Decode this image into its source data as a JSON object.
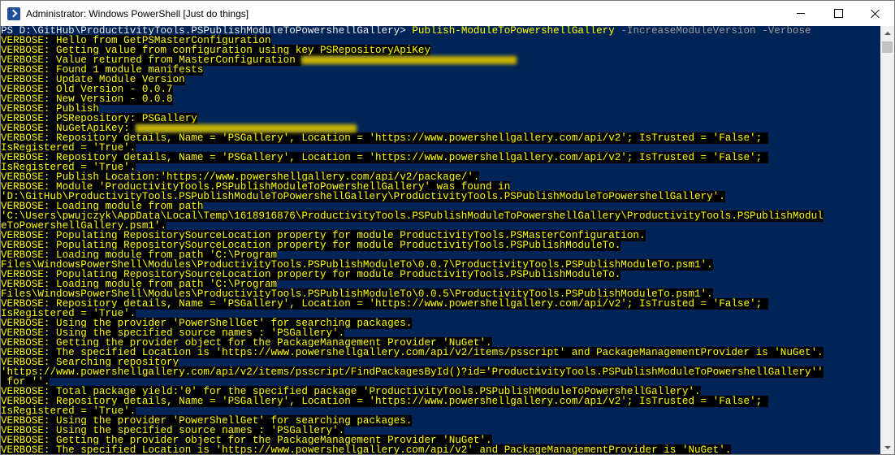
{
  "window": {
    "title": "Administrator: Windows PowerShell [Just do things]"
  },
  "colors": {
    "console_bg": "#012456",
    "verbose_fg": "#ffff00",
    "verbose_bg": "#000000",
    "param_fg": "#9a9a9a"
  },
  "icons": {
    "app": "powershell-icon",
    "minimize": "minimize-icon",
    "maximize": "maximize-icon",
    "close": "close-icon"
  },
  "console": {
    "prompt": "PS D:\\GitHub\\ProductivityTools.PSPublishModuleToPowershellGallery> ",
    "command": "Publish-ModuleToPowershellGallery",
    "parameters": " -IncreaseModuleVersion -Verbose",
    "lines": [
      {
        "text": "VERBOSE: Hello from GetPSMasterConfiguration"
      },
      {
        "text": "VERBOSE: Getting value from configuration using key PSRepositoryApiKey"
      },
      {
        "text": "VERBOSE: Value returned from MasterConfiguration ",
        "redacted": "xxxxxxxxxxxxxxxxxxxxxxxxxxxxxxxxxxx"
      },
      {
        "text": "VERBOSE: Found 1 module manifests"
      },
      {
        "text": "VERBOSE: Update Module Version"
      },
      {
        "text": "VERBOSE: Old Version - 0.0.7"
      },
      {
        "text": "VERBOSE: New Version - 0.0.8"
      },
      {
        "text": "VERBOSE: Publish"
      },
      {
        "text": "VERBOSE: PSRepository: PSGallery"
      },
      {
        "text": "VERBOSE: NuGetApiKey: ",
        "redacted": "xxxxxxxxxxxxxxxxxxxxxxxxxxxxxxxxxxxx"
      },
      {
        "text": "VERBOSE: Repository details, Name = 'PSGallery', Location = 'https://www.powershellgallery.com/api/v2'; IsTrusted = 'False'; "
      },
      {
        "text": "IsRegistered = 'True'."
      },
      {
        "text": "VERBOSE: Repository details, Name = 'PSGallery', Location = 'https://www.powershellgallery.com/api/v2'; IsTrusted = 'False'; "
      },
      {
        "text": "IsRegistered = 'True'."
      },
      {
        "text": "VERBOSE: Publish Location:'https://www.powershellgallery.com/api/v2/package/'."
      },
      {
        "text": "VERBOSE: Module 'ProductivityTools.PSPublishModuleToPowershellGallery' was found in"
      },
      {
        "text": "'D:\\GitHub\\ProductivityTools.PSPublishModuleToPowershellGallery\\ProductivityTools.PSPublishModuleToPowershellGallery'."
      },
      {
        "text": "VERBOSE: Loading module from path"
      },
      {
        "text": "'C:\\Users\\pwujczyk\\AppData\\Local\\Temp\\1618916876\\ProductivityTools.PSPublishModuleToPowershellGallery\\ProductivityTools.PSPublishModul"
      },
      {
        "text": "eToPowershellGallery.psm1'."
      },
      {
        "text": "VERBOSE: Populating RepositorySourceLocation property for module ProductivityTools.PSMasterConfiguration."
      },
      {
        "text": "VERBOSE: Populating RepositorySourceLocation property for module ProductivityTools.PSPublishModuleTo."
      },
      {
        "text": "VERBOSE: Loading module from path 'C:\\Program"
      },
      {
        "text": "Files\\WindowsPowerShell\\Modules\\ProductivityTools.PSPublishModuleTo\\0.0.7\\ProductivityTools.PSPublishModuleTo.psm1'."
      },
      {
        "text": "VERBOSE: Populating RepositorySourceLocation property for module ProductivityTools.PSPublishModuleTo."
      },
      {
        "text": "VERBOSE: Loading module from path 'C:\\Program"
      },
      {
        "text": "Files\\WindowsPowerShell\\Modules\\ProductivityTools.PSPublishModuleTo\\0.0.5\\ProductivityTools.PSPublishModuleTo.psm1'."
      },
      {
        "text": "VERBOSE: Repository details, Name = 'PSGallery', Location = 'https://www.powershellgallery.com/api/v2'; IsTrusted = 'False'; "
      },
      {
        "text": "IsRegistered = 'True'."
      },
      {
        "text": "VERBOSE: Using the provider 'PowerShellGet' for searching packages."
      },
      {
        "text": "VERBOSE: Using the specified source names : 'PSGallery'."
      },
      {
        "text": "VERBOSE: Getting the provider object for the PackageManagement Provider 'NuGet'."
      },
      {
        "text": "VERBOSE: The specified Location is 'https://www.powershellgallery.com/api/v2/items/psscript' and PackageManagementProvider is 'NuGet'."
      },
      {
        "text": "VERBOSE: Searching repository"
      },
      {
        "text": "'https://www.powershellgallery.com/api/v2/items/psscript/FindPackagesById()?id='ProductivityTools.PSPublishModuleToPowershellGallery''"
      },
      {
        "text": " for ''."
      },
      {
        "text": "VERBOSE: Total package yield:'0' for the specified package 'ProductivityTools.PSPublishModuleToPowershellGallery'."
      },
      {
        "text": "VERBOSE: Repository details, Name = 'PSGallery', Location = 'https://www.powershellgallery.com/api/v2'; IsTrusted = 'False'; "
      },
      {
        "text": "IsRegistered = 'True'."
      },
      {
        "text": "VERBOSE: Using the provider 'PowerShellGet' for searching packages."
      },
      {
        "text": "VERBOSE: Using the specified source names : 'PSGallery'."
      },
      {
        "text": "VERBOSE: Getting the provider object for the PackageManagement Provider 'NuGet'."
      },
      {
        "text": "VERBOSE: The specified Location is 'https://www.powershellgallery.com/api/v2' and PackageManagementProvider is 'NuGet'."
      }
    ]
  }
}
